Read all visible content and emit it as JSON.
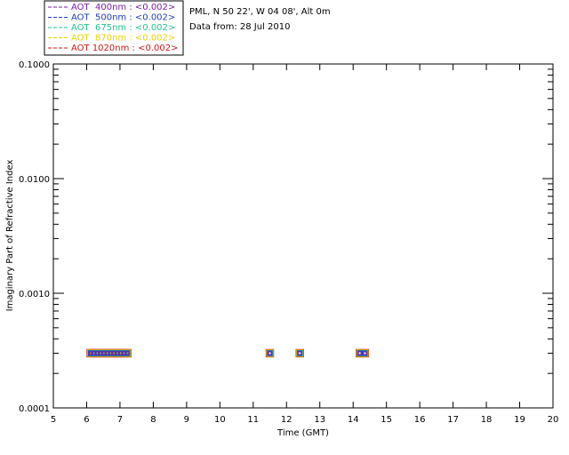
{
  "header": {
    "location": "PML, N 50 22', W 04 08', Alt 0m",
    "date_line": "Data from: 28 Jul 2010"
  },
  "chart_data": {
    "type": "scatter",
    "title": "",
    "xlabel": "Time (GMT)",
    "ylabel": "Imaginary Part of Refractive Index",
    "xlim": [
      5,
      20
    ],
    "ylim": [
      0.0001,
      0.1
    ],
    "yscale": "log",
    "grid": false,
    "legend_position": "top-left",
    "x_ticks": [
      5,
      6,
      7,
      8,
      9,
      10,
      11,
      12,
      13,
      14,
      15,
      16,
      17,
      18,
      19,
      20
    ],
    "y_ticks": [
      {
        "value": 0.0001,
        "label": "0.0001"
      },
      {
        "value": 0.001,
        "label": "0.0010"
      },
      {
        "value": 0.01,
        "label": "0.0100"
      },
      {
        "value": 0.1,
        "label": "0.1000"
      }
    ],
    "x": [
      6.12,
      6.22,
      6.32,
      6.42,
      6.52,
      6.62,
      6.72,
      6.82,
      6.92,
      7.02,
      7.12,
      7.22,
      11.5,
      12.4,
      14.2,
      14.35
    ],
    "series": [
      {
        "name": "AOT  400nm : <0.002>",
        "color": "#7a1fa8",
        "values": [
          0.0003,
          0.0003,
          0.0003,
          0.0003,
          0.0003,
          0.0003,
          0.0003,
          0.0003,
          0.0003,
          0.0003,
          0.0003,
          0.0003,
          0.0003,
          0.0003,
          0.0003,
          0.0003
        ]
      },
      {
        "name": "AOT  500nm : <0.002>",
        "color": "#1f3fbf",
        "values": [
          0.0003,
          0.0003,
          0.0003,
          0.0003,
          0.0003,
          0.0003,
          0.0003,
          0.0003,
          0.0003,
          0.0003,
          0.0003,
          0.0003,
          0.0003,
          0.0003,
          0.0003,
          0.0003
        ]
      },
      {
        "name": "AOT  675nm : <0.002>",
        "color": "#22c48a",
        "values": [
          0.0003,
          0.0003,
          0.0003,
          0.0003,
          0.0003,
          0.0003,
          0.0003,
          0.0003,
          0.0003,
          0.0003,
          0.0003,
          0.0003,
          0.0003,
          0.0003,
          0.0003,
          0.0003
        ]
      },
      {
        "name": "AOT  870nm : <0.002>",
        "color": "#e8d200",
        "values": [
          0.0003,
          0.0003,
          0.0003,
          0.0003,
          0.0003,
          0.0003,
          0.0003,
          0.0003,
          0.0003,
          0.0003,
          0.0003,
          0.0003,
          0.0003,
          0.0003,
          0.0003,
          0.0003
        ]
      },
      {
        "name": "AOT 1020nm : <0.002>",
        "color": "#d01818",
        "values": [
          0.0003,
          0.0003,
          0.0003,
          0.0003,
          0.0003,
          0.0003,
          0.0003,
          0.0003,
          0.0003,
          0.0003,
          0.0003,
          0.0003,
          0.0003,
          0.0003,
          0.0003,
          0.0003
        ]
      }
    ]
  }
}
